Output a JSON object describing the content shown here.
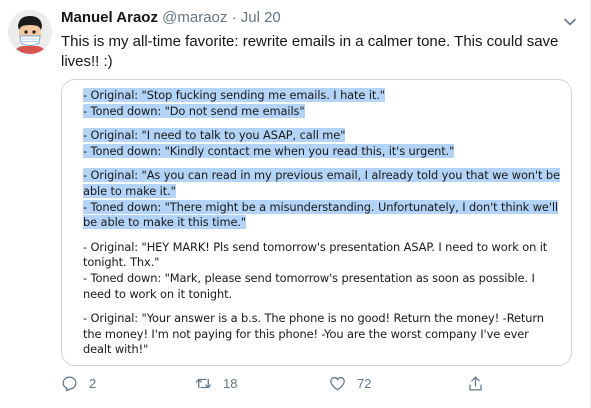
{
  "tweet": {
    "author_name": "Manuel Araoz",
    "handle": "@maraoz",
    "separator": "·",
    "date": "Jul 20",
    "text": "This is my all-time favorite: rewrite emails in a calmer tone. This could save lives!! :)"
  },
  "card": {
    "lines": [
      {
        "text": "- Original: \"Stop fucking sending me emails. I hate it.\"",
        "highlighted": true
      },
      {
        "text": "- Toned down: \"Do not send me emails\"",
        "highlighted": true
      },
      {
        "text": "",
        "highlighted": true
      },
      {
        "text": "- Original: \"I need to talk to you ASAP, call me\"",
        "highlighted": true
      },
      {
        "text": "- Toned down: \"Kindly contact me when you read this, it's urgent.\"",
        "highlighted": true
      },
      {
        "text": "",
        "highlighted": true
      },
      {
        "text": "- Original: \"As you can read in my previous email, I already told you that we won't be",
        "highlighted": true
      },
      {
        "text": "able to make it.\"",
        "highlighted": true
      },
      {
        "text": "- Toned down: \"There might be a misunderstanding. Unfortunately, I don't think we'll",
        "highlighted": true
      },
      {
        "text": "be able to make it this time.\"",
        "highlighted": true
      },
      {
        "text": "",
        "highlighted": false
      },
      {
        "text": "- Original: \"HEY MARK! Pls send tomorrow's presentation ASAP. I need to work on it",
        "highlighted": false
      },
      {
        "text": "tonight. Thx.\"",
        "highlighted": false
      },
      {
        "text": "- Toned down: \"Mark, please send tomorrow's presentation as soon as possible. I",
        "highlighted": false
      },
      {
        "text": "need to work on it tonight.",
        "highlighted": false
      },
      {
        "text": "",
        "highlighted": false
      },
      {
        "text": "- Original: \"Your answer is a b.s. The phone is no good! Return the money! -Return",
        "highlighted": false
      },
      {
        "text": "the money! I'm not paying for this phone! -You are the worst company I've ever",
        "highlighted": false
      },
      {
        "text": "dealt with!\"",
        "highlighted": false
      }
    ]
  },
  "actions": {
    "reply_count": "2",
    "retweet_count": "18",
    "like_count": "72"
  },
  "icons": {
    "caret": "chevron-down-icon",
    "reply": "reply-icon",
    "retweet": "retweet-icon",
    "like": "heart-icon",
    "share": "share-icon"
  },
  "colors": {
    "secondary_text": "#657786",
    "selection_highlight": "#b4d4f7",
    "card_border": "#ccd6dd"
  }
}
